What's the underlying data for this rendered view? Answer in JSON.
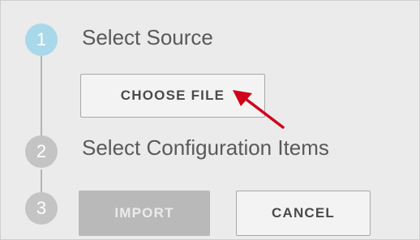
{
  "wizard": {
    "steps": [
      {
        "number": "1",
        "label": "Select Source",
        "state": "active"
      },
      {
        "number": "2",
        "label": "Select Configuration Items",
        "state": "inactive"
      },
      {
        "number": "3",
        "label": "",
        "state": "inactive"
      }
    ],
    "choose_file_label": "CHOOSE FILE",
    "import_label": "IMPORT",
    "cancel_label": "CANCEL"
  },
  "colors": {
    "panel_bg": "#ebebeb",
    "active_step": "#a9d8ea",
    "inactive_step": "#c4c4c4",
    "disabled_button": "#b9b9b9",
    "annotation_arrow": "#d0021b"
  },
  "icons": {
    "annotation": "red-arrow-icon"
  }
}
